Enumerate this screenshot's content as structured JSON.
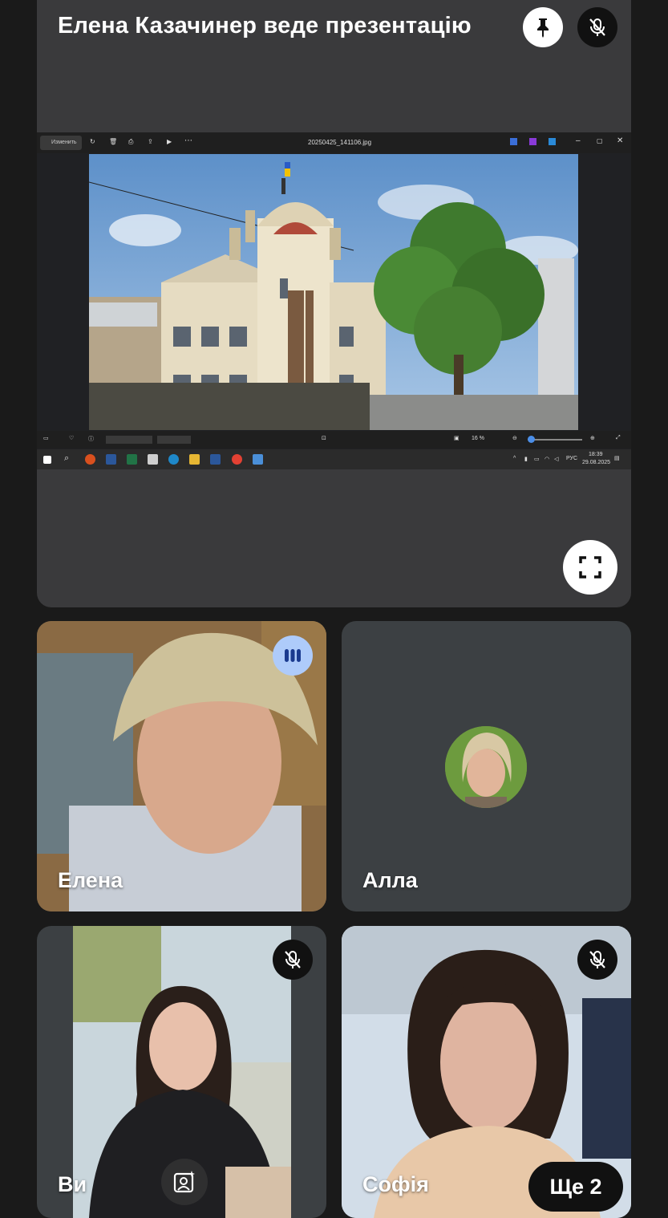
{
  "presenter": {
    "title": "Елена Казачинер веде презентацію",
    "pin_icon": "pin-icon",
    "mic_icon": "mic-off-icon"
  },
  "shared_screen": {
    "viewer": {
      "edit_label": "Изменить",
      "file_name": "20250425_141106.jpg",
      "zoom_level": "16 %"
    },
    "taskbar": {
      "lang": "РУС",
      "time": "18:39",
      "date": "29.08.2025"
    }
  },
  "participants": [
    {
      "name": "Елена",
      "speaking": true
    },
    {
      "name": "Алла",
      "avatar": true
    },
    {
      "name": "Ви",
      "muted": true
    },
    {
      "name": "Софія",
      "muted": true
    }
  ],
  "more_button": {
    "label": "Ще 2"
  },
  "colors": {
    "background": "#1a1a1a",
    "tile": "#3c4043",
    "speaking_badge": "#aecbfa",
    "speaking_bars": "#1a3a8f"
  }
}
